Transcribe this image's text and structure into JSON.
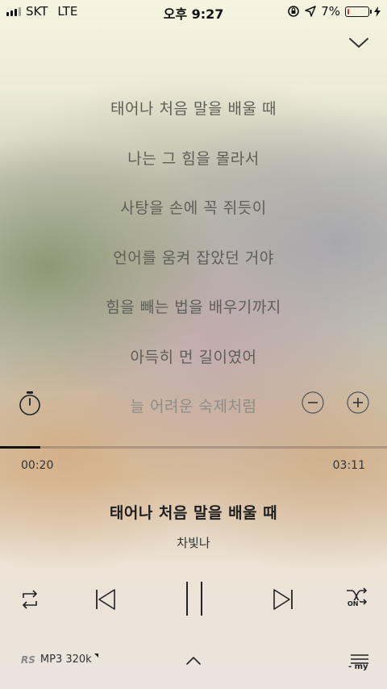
{
  "status_bar": {
    "carrier": "SKT",
    "network": "LTE",
    "time": "오후 9:27",
    "battery_percent": "7%",
    "battery_level": 0.07,
    "battery_color": "#e0302a"
  },
  "header": {
    "collapse_icon": "chevron-down-icon"
  },
  "lyrics": [
    {
      "text": "태어나 처음 말을 배울 때"
    },
    {
      "text": "나는 그 힘을 몰라서"
    },
    {
      "text": "사탕을 손에 꼭 쥐듯이"
    },
    {
      "text": "언어를 움켜 잡았던 거야"
    },
    {
      "text": "힘을 빼는 법을 배우기까지"
    },
    {
      "text": "아득히 먼 길이였어"
    },
    {
      "text": "늘 어려운 숙제처럼"
    }
  ],
  "lyric_tools": {
    "timer_icon": "timer-icon",
    "minus_icon": "minus-circle-icon",
    "plus_icon": "plus-circle-icon"
  },
  "progress": {
    "elapsed": "00:20",
    "total": "03:11",
    "fraction": 0.105
  },
  "track": {
    "title": "태어나 처음 말을 배울 때",
    "artist": "차빛나"
  },
  "controls": {
    "repeat_icon": "repeat-icon",
    "prev_icon": "skip-previous-icon",
    "pause_icon": "pause-icon",
    "next_icon": "skip-next-icon",
    "shuffle_icon": "shuffle-icon",
    "shuffle_label": "ON"
  },
  "footer": {
    "rs_label": "RS",
    "quality_label": "MP3 320k",
    "more_icon": "chevron-up-icon",
    "mylist_label": "- my"
  }
}
